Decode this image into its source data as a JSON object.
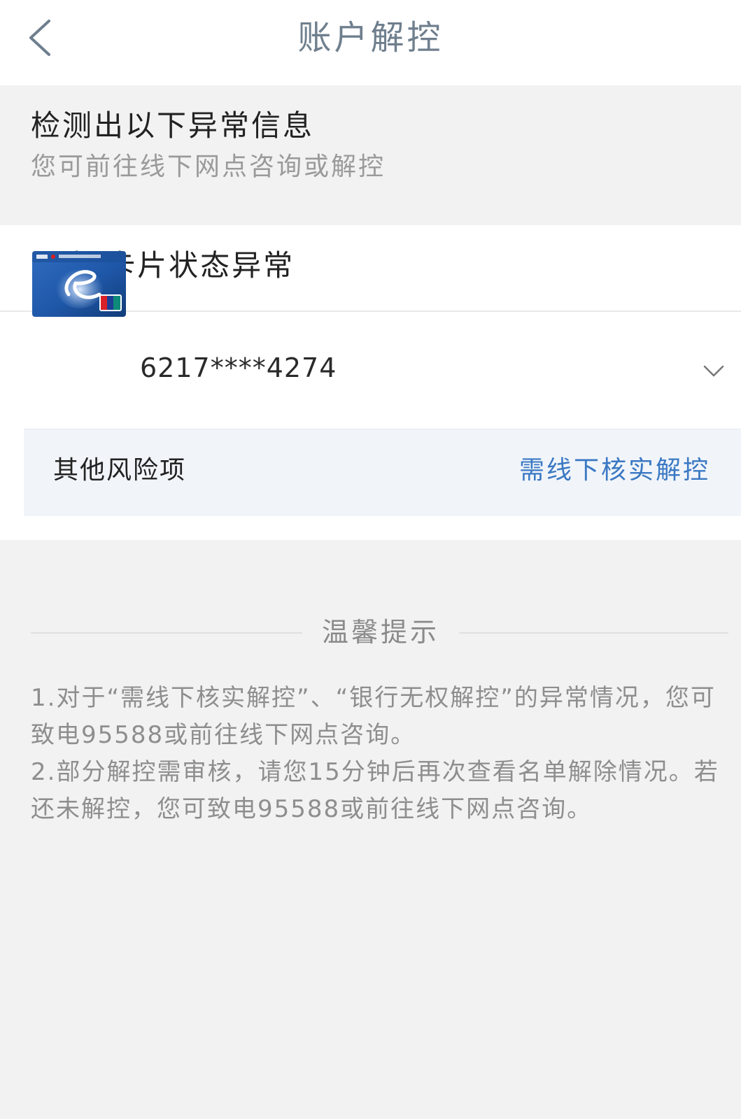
{
  "header": {
    "title": "账户解控",
    "back_icon": "chevron-left-icon"
  },
  "notice": {
    "title": "检测出以下异常信息",
    "subtitle": "您可前往线下网点咨询或解控"
  },
  "status_card": {
    "title": "账户/卡片状态异常",
    "card": {
      "number": "6217****4274",
      "image": "bank-card-image",
      "expand_icon": "chevron-down-icon"
    },
    "risk": {
      "label": "其他风险项",
      "action": "需线下核实解控"
    }
  },
  "tips": {
    "title": "温馨提示",
    "items": [
      "1.对于“需线下核实解控”、“银行无权解控”的异常情况，您可致电95588或前往线下网点咨询。",
      "2.部分解控需审核，请您15分钟后再次查看名单解除情况。若还未解控，您可致电95588或前往线下网点咨询。"
    ]
  },
  "colors": {
    "title_gray": "#6f7f8e",
    "link_blue": "#3a78c3",
    "risk_bg": "#f1f5fa",
    "page_bg": "#f2f2f2"
  }
}
